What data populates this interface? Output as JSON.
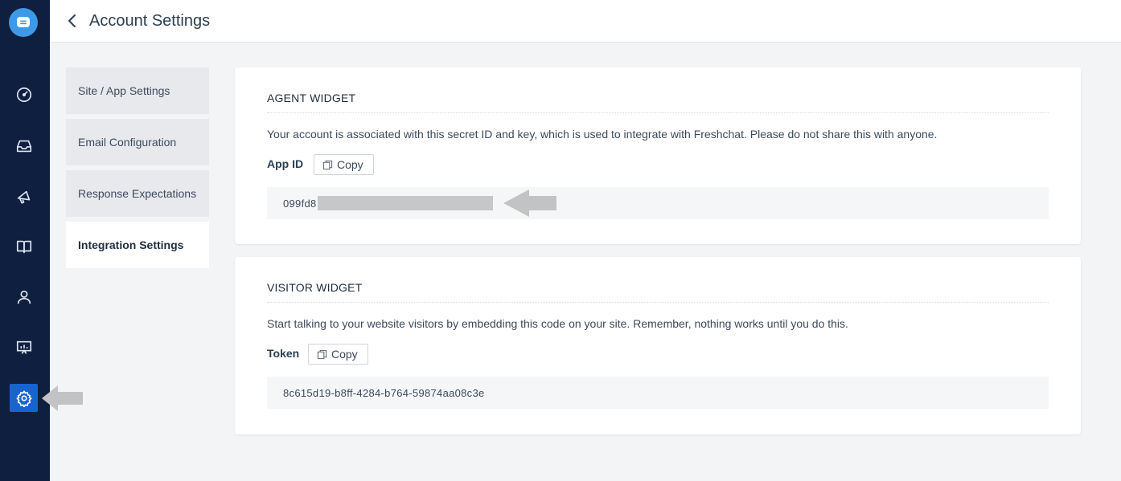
{
  "header": {
    "title": "Account Settings"
  },
  "rail": {
    "items": [
      {
        "name": "dashboard-icon"
      },
      {
        "name": "inbox-icon"
      },
      {
        "name": "campaigns-icon"
      },
      {
        "name": "faq-icon"
      },
      {
        "name": "contacts-icon"
      },
      {
        "name": "reports-icon"
      },
      {
        "name": "settings-icon",
        "active": true
      }
    ]
  },
  "subnav": {
    "items": [
      {
        "label": "Site / App Settings"
      },
      {
        "label": "Email Configuration"
      },
      {
        "label": "Response Expectations"
      },
      {
        "label": "Integration Settings",
        "active": true
      }
    ]
  },
  "agent_widget": {
    "title": "AGENT WIDGET",
    "description": "Your account is associated with this secret ID and key, which is used to integrate with Freshchat. Please do not share this with anyone.",
    "field_label": "App ID",
    "copy_label": "Copy",
    "value_visible": "099fd8"
  },
  "visitor_widget": {
    "title": "VISITOR WIDGET",
    "description": "Start talking to your website visitors by embedding this code on your site. Remember, nothing works until you do this.",
    "field_label": "Token",
    "copy_label": "Copy",
    "value": "8c615d19-b8ff-4284-b764-59874aa08c3e"
  },
  "colors": {
    "rail": "#0f1f40",
    "accent": "#1764d1",
    "logo": "#3d9ae8",
    "page_bg": "#f3f4f6"
  }
}
